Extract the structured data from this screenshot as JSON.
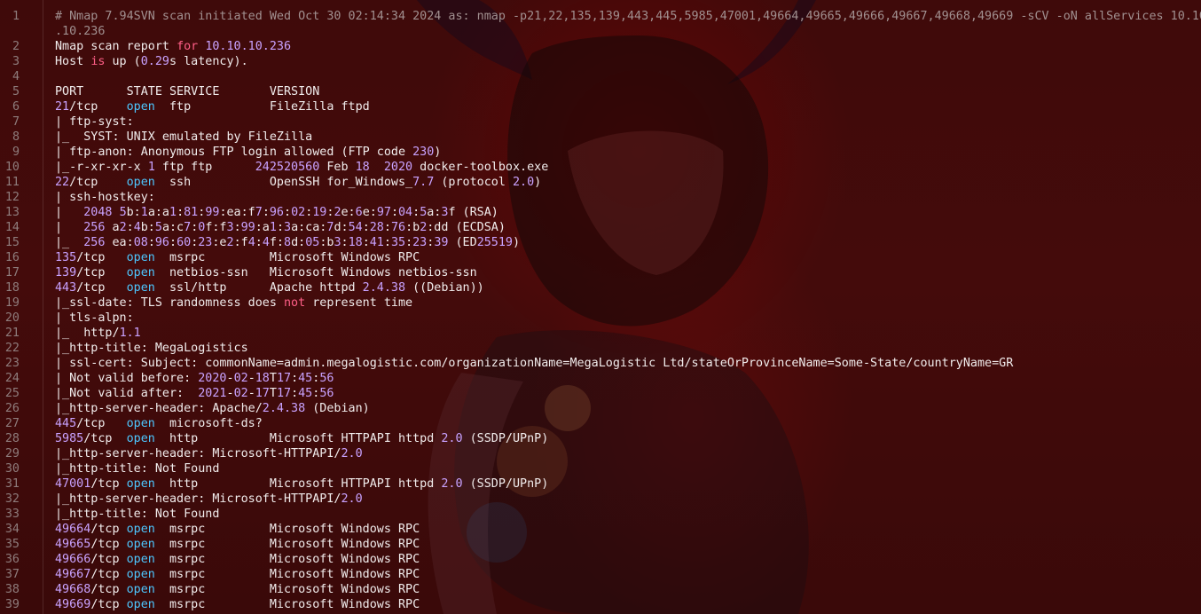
{
  "colors": {
    "text": "#f1ecec",
    "comment": "#a19090",
    "number": "#c9a2ff",
    "keyword": "#ff5f87",
    "state_open": "#4dc7ff",
    "line_number": "#8e7c7c",
    "background": "#3f0a0a"
  },
  "editor": {
    "lines": [
      {
        "n": "1",
        "text": "# Nmap 7.94SVN scan initiated Wed Oct 30 02:14:34 2024 as: nmap -p21,22,135,139,443,445,5985,47001,49664,49665,49666,49667,49668,49669 -sCV -oN allServices 10.10"
      },
      {
        "n": "",
        "text": ".10.236"
      },
      {
        "n": "2",
        "text": "Nmap scan report for 10.10.10.236"
      },
      {
        "n": "3",
        "text": "Host is up (0.29s latency)."
      },
      {
        "n": "4",
        "text": ""
      },
      {
        "n": "5",
        "text": "PORT      STATE SERVICE       VERSION"
      },
      {
        "n": "6",
        "text": "21/tcp    open  ftp           FileZilla ftpd"
      },
      {
        "n": "7",
        "text": "| ftp-syst:"
      },
      {
        "n": "8",
        "text": "|_  SYST: UNIX emulated by FileZilla"
      },
      {
        "n": "9",
        "text": "| ftp-anon: Anonymous FTP login allowed (FTP code 230)"
      },
      {
        "n": "10",
        "text": "|_-r-xr-xr-x 1 ftp ftp      242520560 Feb 18  2020 docker-toolbox.exe"
      },
      {
        "n": "11",
        "text": "22/tcp    open  ssh           OpenSSH for_Windows_7.7 (protocol 2.0)"
      },
      {
        "n": "12",
        "text": "| ssh-hostkey:"
      },
      {
        "n": "13",
        "text": "|   2048 5b:1a:a1:81:99:ea:f7:96:02:19:2e:6e:97:04:5a:3f (RSA)"
      },
      {
        "n": "14",
        "text": "|   256 a2:4b:5a:c7:0f:f3:99:a1:3a:ca:7d:54:28:76:b2:dd (ECDSA)"
      },
      {
        "n": "15",
        "text": "|_  256 ea:08:96:60:23:e2:f4:4f:8d:05:b3:18:41:35:23:39 (ED25519)"
      },
      {
        "n": "16",
        "text": "135/tcp   open  msrpc         Microsoft Windows RPC"
      },
      {
        "n": "17",
        "text": "139/tcp   open  netbios-ssn   Microsoft Windows netbios-ssn"
      },
      {
        "n": "18",
        "text": "443/tcp   open  ssl/http      Apache httpd 2.4.38 ((Debian))"
      },
      {
        "n": "19",
        "text": "|_ssl-date: TLS randomness does not represent time"
      },
      {
        "n": "20",
        "text": "| tls-alpn:"
      },
      {
        "n": "21",
        "text": "|_  http/1.1"
      },
      {
        "n": "22",
        "text": "|_http-title: MegaLogistics"
      },
      {
        "n": "23",
        "text": "| ssl-cert: Subject: commonName=admin.megalogistic.com/organizationName=MegaLogistic Ltd/stateOrProvinceName=Some-State/countryName=GR"
      },
      {
        "n": "24",
        "text": "| Not valid before: 2020-02-18T17:45:56"
      },
      {
        "n": "25",
        "text": "|_Not valid after:  2021-02-17T17:45:56"
      },
      {
        "n": "26",
        "text": "|_http-server-header: Apache/2.4.38 (Debian)"
      },
      {
        "n": "27",
        "text": "445/tcp   open  microsoft-ds?"
      },
      {
        "n": "28",
        "text": "5985/tcp  open  http          Microsoft HTTPAPI httpd 2.0 (SSDP/UPnP)"
      },
      {
        "n": "29",
        "text": "|_http-server-header: Microsoft-HTTPAPI/2.0"
      },
      {
        "n": "30",
        "text": "|_http-title: Not Found"
      },
      {
        "n": "31",
        "text": "47001/tcp open  http          Microsoft HTTPAPI httpd 2.0 (SSDP/UPnP)"
      },
      {
        "n": "32",
        "text": "|_http-server-header: Microsoft-HTTPAPI/2.0"
      },
      {
        "n": "33",
        "text": "|_http-title: Not Found"
      },
      {
        "n": "34",
        "text": "49664/tcp open  msrpc         Microsoft Windows RPC"
      },
      {
        "n": "35",
        "text": "49665/tcp open  msrpc         Microsoft Windows RPC"
      },
      {
        "n": "36",
        "text": "49666/tcp open  msrpc         Microsoft Windows RPC"
      },
      {
        "n": "37",
        "text": "49667/tcp open  msrpc         Microsoft Windows RPC"
      },
      {
        "n": "38",
        "text": "49668/tcp open  msrpc         Microsoft Windows RPC"
      },
      {
        "n": "39",
        "text": "49669/tcp open  msrpc         Microsoft Windows RPC"
      }
    ]
  }
}
